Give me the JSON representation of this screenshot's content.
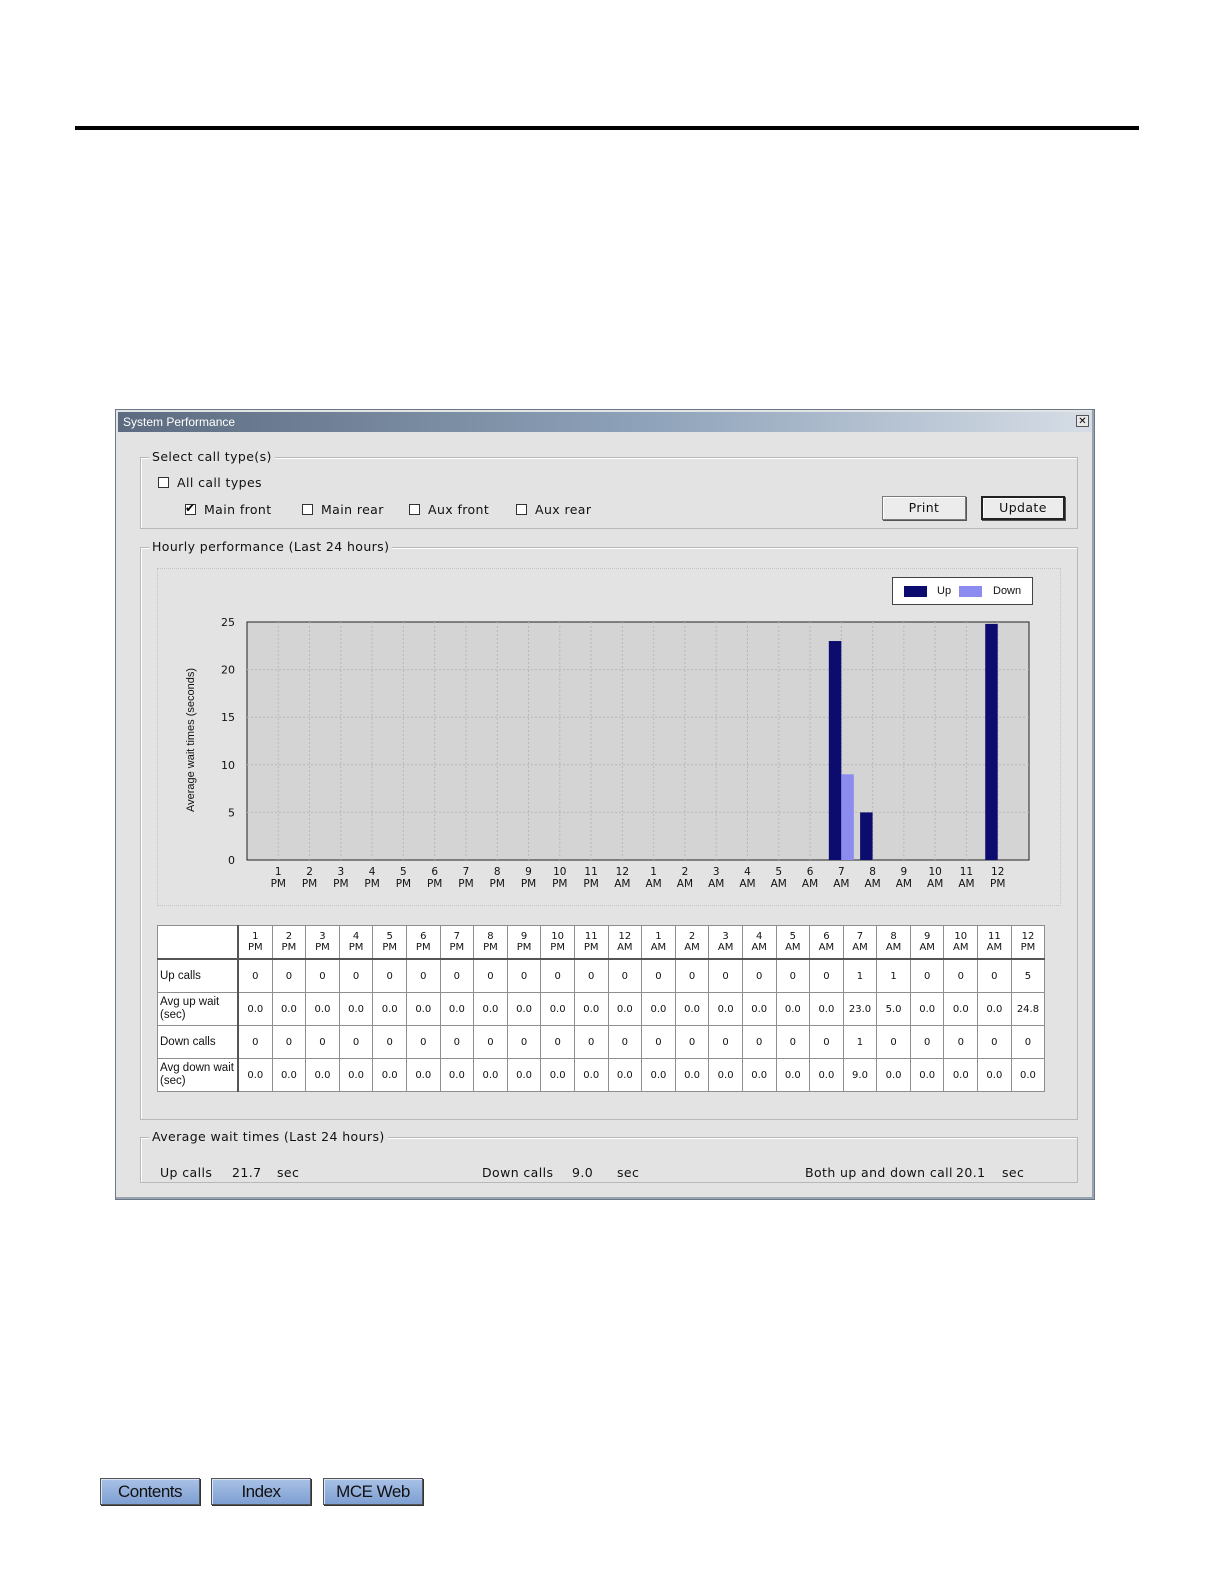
{
  "window": {
    "title": "System Performance",
    "close_glyph": "✕"
  },
  "call_types": {
    "legend": "Select call type(s)",
    "all": {
      "label": "All call types",
      "checked": false
    },
    "main_front": {
      "label": "Main front",
      "checked": true
    },
    "main_rear": {
      "label": "Main rear",
      "checked": false
    },
    "aux_front": {
      "label": "Aux front",
      "checked": false
    },
    "aux_rear": {
      "label": "Aux rear",
      "checked": false
    },
    "print_label": "Print",
    "update_label": "Update"
  },
  "hourly": {
    "legend": "Hourly performance (Last 24 hours)",
    "rows": [
      {
        "label": "Up calls",
        "values": [
          "0",
          "0",
          "0",
          "0",
          "0",
          "0",
          "0",
          "0",
          "0",
          "0",
          "0",
          "0",
          "0",
          "0",
          "0",
          "0",
          "0",
          "0",
          "1",
          "1",
          "0",
          "0",
          "0",
          "5"
        ]
      },
      {
        "label": "Avg up wait (sec)",
        "values": [
          "0.0",
          "0.0",
          "0.0",
          "0.0",
          "0.0",
          "0.0",
          "0.0",
          "0.0",
          "0.0",
          "0.0",
          "0.0",
          "0.0",
          "0.0",
          "0.0",
          "0.0",
          "0.0",
          "0.0",
          "0.0",
          "23.0",
          "5.0",
          "0.0",
          "0.0",
          "0.0",
          "24.8"
        ]
      },
      {
        "label": "Down calls",
        "values": [
          "0",
          "0",
          "0",
          "0",
          "0",
          "0",
          "0",
          "0",
          "0",
          "0",
          "0",
          "0",
          "0",
          "0",
          "0",
          "0",
          "0",
          "0",
          "1",
          "0",
          "0",
          "0",
          "0",
          "0"
        ]
      },
      {
        "label": "Avg down wait (sec)",
        "values": [
          "0.0",
          "0.0",
          "0.0",
          "0.0",
          "0.0",
          "0.0",
          "0.0",
          "0.0",
          "0.0",
          "0.0",
          "0.0",
          "0.0",
          "0.0",
          "0.0",
          "0.0",
          "0.0",
          "0.0",
          "0.0",
          "9.0",
          "0.0",
          "0.0",
          "0.0",
          "0.0",
          "0.0"
        ]
      }
    ]
  },
  "chart_data": {
    "type": "bar",
    "title": "",
    "xlabel": "",
    "ylabel": "Average wait times (seconds)",
    "ylim": [
      0,
      25
    ],
    "yticks": [
      0,
      5,
      10,
      15,
      20,
      25
    ],
    "grid": true,
    "legend_position": "top-right",
    "categories": [
      [
        "1",
        "PM"
      ],
      [
        "2",
        "PM"
      ],
      [
        "3",
        "PM"
      ],
      [
        "4",
        "PM"
      ],
      [
        "5",
        "PM"
      ],
      [
        "6",
        "PM"
      ],
      [
        "7",
        "PM"
      ],
      [
        "8",
        "PM"
      ],
      [
        "9",
        "PM"
      ],
      [
        "10",
        "PM"
      ],
      [
        "11",
        "PM"
      ],
      [
        "12",
        "AM"
      ],
      [
        "1",
        "AM"
      ],
      [
        "2",
        "AM"
      ],
      [
        "3",
        "AM"
      ],
      [
        "4",
        "AM"
      ],
      [
        "5",
        "AM"
      ],
      [
        "6",
        "AM"
      ],
      [
        "7",
        "AM"
      ],
      [
        "8",
        "AM"
      ],
      [
        "9",
        "AM"
      ],
      [
        "10",
        "AM"
      ],
      [
        "11",
        "AM"
      ],
      [
        "12",
        "PM"
      ]
    ],
    "series": [
      {
        "name": "Up",
        "color": "#0c0c6e",
        "values": [
          0,
          0,
          0,
          0,
          0,
          0,
          0,
          0,
          0,
          0,
          0,
          0,
          0,
          0,
          0,
          0,
          0,
          0,
          23.0,
          5.0,
          0,
          0,
          0,
          24.8
        ]
      },
      {
        "name": "Down",
        "color": "#8b8bf0",
        "values": [
          0,
          0,
          0,
          0,
          0,
          0,
          0,
          0,
          0,
          0,
          0,
          0,
          0,
          0,
          0,
          0,
          0,
          0,
          9.0,
          0,
          0,
          0,
          0,
          0
        ]
      }
    ],
    "plot_background": "#d4d4d4"
  },
  "averages": {
    "legend": "Average wait times (Last 24 hours)",
    "up_label": "Up calls",
    "up_value": "21.7",
    "up_unit": "sec",
    "down_label": "Down calls",
    "down_value": "9.0",
    "down_unit": "sec",
    "both_label": "Both up and down call",
    "both_value": "20.1",
    "both_unit": "sec"
  },
  "nav": {
    "contents": "Contents",
    "index": "Index",
    "mce_web": "MCE Web"
  }
}
